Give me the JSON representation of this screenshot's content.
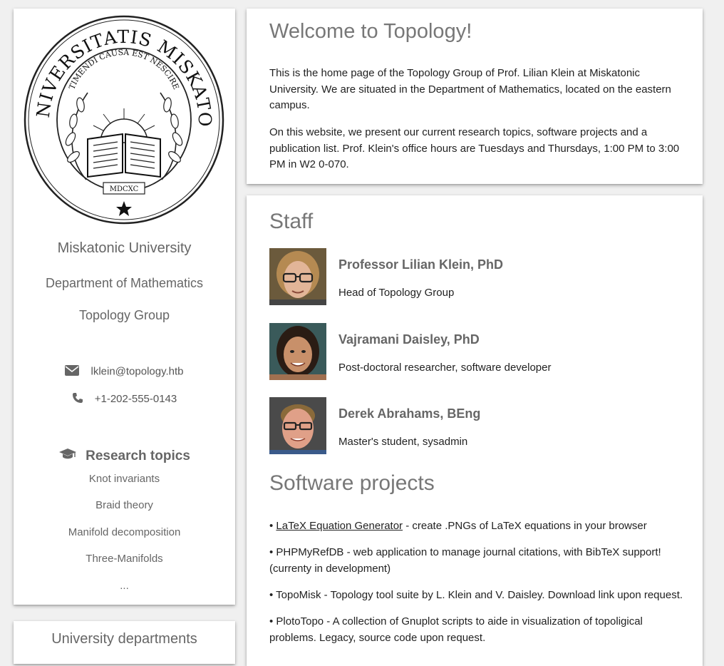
{
  "sidebar": {
    "university": "Miskatonic University",
    "department": "Department of Mathematics",
    "group": "Topology Group",
    "seal": {
      "outer_text": "SIGILLVM VNIVERSITATIS MISKATONICIENSIS",
      "inner_text": "TIMENDI CAUSA EST NESCIRE",
      "year": "MDCXC"
    },
    "contact": {
      "email_icon": "envelope-icon",
      "email": "lklein@topology.htb",
      "phone_icon": "phone-icon",
      "phone": "+1-202-555-0143"
    },
    "research": {
      "icon": "graduation-cap-icon",
      "title": "Research topics",
      "items": [
        "Knot invariants",
        "Braid theory",
        "Manifold decomposition",
        "Three-Manifolds",
        "..."
      ]
    },
    "departments_title": "University departments"
  },
  "welcome": {
    "title": "Welcome to Topology!",
    "para1": "This is the home page of the Topology Group of Prof. Lilian Klein at Miskatonic University. We are situated in the Department of Mathematics, located on the eastern campus.",
    "para2": "On this website, we present our current research topics, software projects and a publication list. Prof. Klein's office hours are Tuesdays and Thursdays, 1:00 PM to 3:00 PM in W2 0-070."
  },
  "staff": {
    "title": "Staff",
    "members": [
      {
        "name": "Professor Lilian Klein, PhD",
        "role": "Head of Topology Group"
      },
      {
        "name": "Vajramani Daisley, PhD",
        "role": "Post-doctoral researcher, software developer"
      },
      {
        "name": "Derek Abrahams, BEng",
        "role": "Master's student, sysadmin"
      }
    ]
  },
  "software": {
    "title": "Software projects",
    "projects": [
      {
        "bullet": "• ",
        "link": "LaTeX Equation Generator",
        "desc": " - create .PNGs of LaTeX equations in your browser"
      },
      {
        "bullet": "• ",
        "text": "PHPMyRefDB - web application to manage journal citations, with BibTeX support! (currenty in development)"
      },
      {
        "bullet": "• ",
        "text": "TopoMisk - Topology tool suite by L. Klein and V. Daisley. Download link upon request."
      },
      {
        "bullet": "• ",
        "text": "PlotoTopo - A collection of Gnuplot scripts to aide in visualization of topoligical problems. Legacy, source code upon request."
      }
    ]
  }
}
